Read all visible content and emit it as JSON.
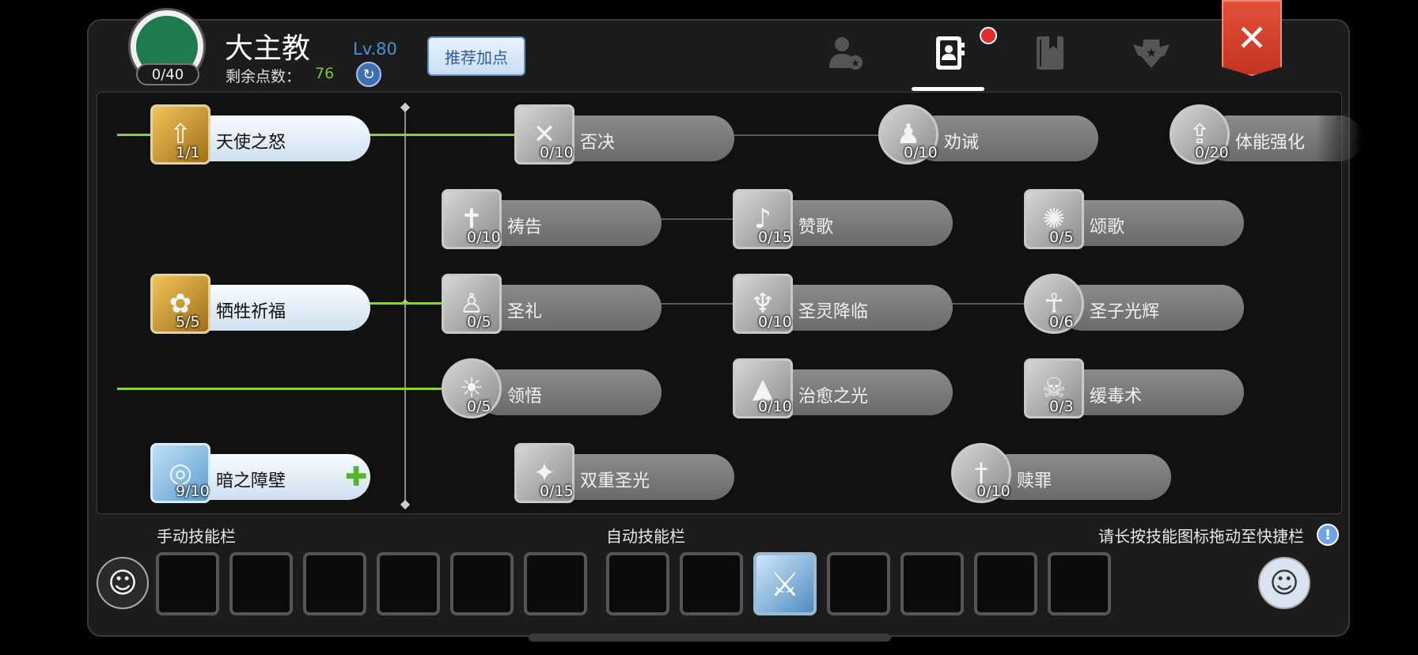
{
  "header": {
    "emblem_count": "0/40",
    "class_name": "大主教",
    "level": "Lv.80",
    "points_label": "剩余点数：",
    "points_value": "76",
    "recommend_label": "推荐加点",
    "tabs": [
      {
        "icon": "character-star-icon"
      },
      {
        "icon": "skill-book-contact-icon",
        "active": true,
        "badge": true
      },
      {
        "icon": "bookmark-book-icon"
      },
      {
        "icon": "winged-star-emblem-icon"
      }
    ],
    "close_label": "✕"
  },
  "skills": [
    {
      "name": "天使之怒",
      "level": "1/1",
      "state": "active",
      "icon": "angel-wrath-icon"
    },
    {
      "name": "否决",
      "level": "0/10",
      "state": "locked",
      "icon": "veto-x-icon"
    },
    {
      "name": "劝诫",
      "level": "0/10",
      "state": "locked",
      "icon": "admonish-icon"
    },
    {
      "name": "体能强化",
      "level": "0/20",
      "state": "locked",
      "icon": "fitness-icon"
    },
    {
      "name": "祷告",
      "level": "0/10",
      "state": "locked",
      "icon": "prayer-icon"
    },
    {
      "name": "赞歌",
      "level": "0/15",
      "state": "locked",
      "icon": "hymn-icon"
    },
    {
      "name": "颂歌",
      "level": "0/5",
      "state": "locked",
      "icon": "chant-icon"
    },
    {
      "name": "牺牲祈福",
      "level": "5/5",
      "state": "active",
      "icon": "sacrifice-blessing-icon"
    },
    {
      "name": "圣礼",
      "level": "0/5",
      "state": "locked",
      "icon": "sacrament-icon"
    },
    {
      "name": "圣灵降临",
      "level": "0/10",
      "state": "locked",
      "icon": "holy-spirit-icon"
    },
    {
      "name": "圣子光辉",
      "level": "0/6",
      "state": "locked",
      "icon": "holy-child-icon"
    },
    {
      "name": "领悟",
      "level": "0/5",
      "state": "locked",
      "icon": "insight-bulb-icon"
    },
    {
      "name": "治愈之光",
      "level": "0/10",
      "state": "locked",
      "icon": "healing-light-icon"
    },
    {
      "name": "缓毒术",
      "level": "0/3",
      "state": "locked",
      "icon": "stop-poison-icon"
    },
    {
      "name": "暗之障壁",
      "level": "9/10",
      "state": "active-blue",
      "icon": "dark-barrier-icon",
      "can_add": true
    },
    {
      "name": "双重圣光",
      "level": "0/15",
      "state": "locked",
      "icon": "double-holy-light-icon"
    },
    {
      "name": "赎罪",
      "level": "0/10",
      "state": "locked",
      "icon": "atonement-icon"
    }
  ],
  "bottom": {
    "manual_label": "手动技能栏",
    "auto_label": "自动技能栏",
    "hint": "请长按技能图标拖动至快捷栏",
    "hint_icon": "!",
    "manual_slots": 6,
    "auto_slots": 7,
    "filled_slot_icon": "sword-burst-icon"
  },
  "colors": {
    "accent_green": "#8ccf3c",
    "close_red": "#c23420",
    "badge_red": "#e02c2c",
    "level_blue": "#4f8fd8"
  }
}
